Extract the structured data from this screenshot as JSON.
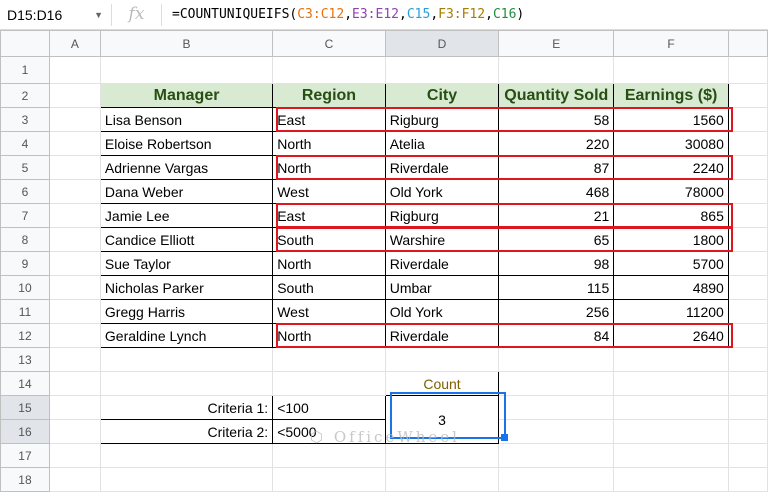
{
  "name_box": "D15:D16",
  "formula_parts": [
    "=COUNTUNIQUEIFS(",
    "C3:C12",
    ",",
    "E3:E12",
    ",",
    "C15",
    ",",
    "F3:F12",
    ",",
    "C16",
    ")"
  ],
  "columns": [
    "A",
    "B",
    "C",
    "D",
    "E",
    "F"
  ],
  "rows": [
    "1",
    "2",
    "3",
    "4",
    "5",
    "6",
    "7",
    "8",
    "9",
    "10",
    "11",
    "12",
    "13",
    "14",
    "15",
    "16",
    "17",
    "18"
  ],
  "headers": [
    "Manager",
    "Region",
    "City",
    "Quantity Sold",
    "Earnings ($)"
  ],
  "data": [
    [
      "Lisa Benson",
      "East",
      "Rigburg",
      "58",
      "1560"
    ],
    [
      "Eloise Robertson",
      "North",
      "Atelia",
      "220",
      "30080"
    ],
    [
      "Adrienne Vargas",
      "North",
      "Riverdale",
      "87",
      "2240"
    ],
    [
      "Dana Weber",
      "West",
      "Old York",
      "468",
      "78000"
    ],
    [
      "Jamie Lee",
      "East",
      "Rigburg",
      "21",
      "865"
    ],
    [
      "Candice Elliott",
      "South",
      "Warshire",
      "65",
      "1800"
    ],
    [
      "Sue Taylor",
      "North",
      "Riverdale",
      "98",
      "5700"
    ],
    [
      "Nicholas Parker",
      "South",
      "Umbar",
      "115",
      "4890"
    ],
    [
      "Gregg Harris",
      "West",
      "Old York",
      "256",
      "11200"
    ],
    [
      "Geraldine Lynch",
      "North",
      "Riverdale",
      "84",
      "2640"
    ]
  ],
  "count_label": "Count",
  "count_value": "3",
  "criteria": [
    {
      "label": "Criteria 1:",
      "value": "<100"
    },
    {
      "label": "Criteria 2:",
      "value": "<5000"
    }
  ],
  "watermark": "OfficeWheel"
}
